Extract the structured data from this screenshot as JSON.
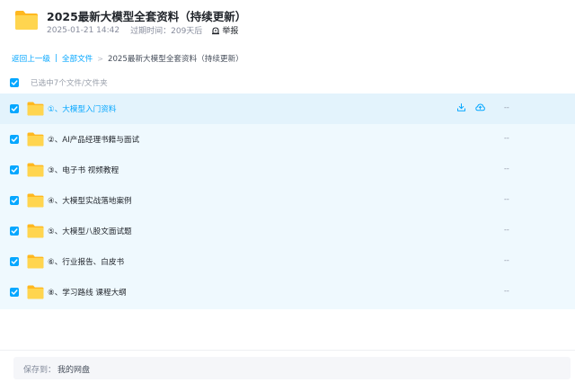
{
  "share": {
    "title": "2025最新大模型全套资料（持续更新）",
    "date": "2025-01-21 14:42",
    "expiry_label": "过期时间：",
    "expiry_value": "209天后",
    "report_label": "举报"
  },
  "breadcrumb": {
    "back": "返回上一级",
    "divider": "|",
    "all_files": "全部文件",
    "arrow": ">",
    "current": "2025最新大模型全套资料（持续更新）"
  },
  "selection": {
    "summary": "已选中7个文件/文件夹"
  },
  "files": [
    {
      "name": "①、大模型入门资料",
      "size": "--",
      "checked": true
    },
    {
      "name": "②、AI产品经理书籍与面试",
      "size": "--",
      "checked": true
    },
    {
      "name": "③、电子书 视频教程",
      "size": "--",
      "checked": true
    },
    {
      "name": "④、大模型实战落地案例",
      "size": "--",
      "checked": true
    },
    {
      "name": "⑤、大模型八股文面试题",
      "size": "--",
      "checked": true
    },
    {
      "name": "⑥、行业报告、白皮书",
      "size": "--",
      "checked": true
    },
    {
      "name": "⑧、学习路线 课程大纲",
      "size": "--",
      "checked": true
    }
  ],
  "row_actions": {
    "download_icon": "download-icon",
    "save_icon": "cloud-save-icon"
  },
  "save_bar": {
    "label": "保存到：",
    "target": "我的网盘"
  },
  "colors": {
    "accent": "#06a7ff",
    "folder": "#ffc53d",
    "list_bg": "#eff9fe"
  }
}
